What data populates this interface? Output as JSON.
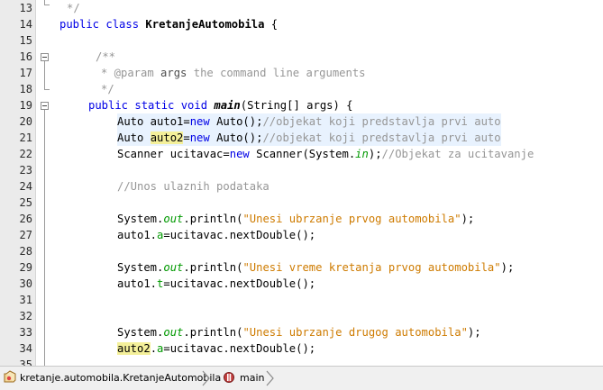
{
  "editor": {
    "line_numbers": [
      "13",
      "14",
      "15",
      "16",
      "17",
      "18",
      "19",
      "20",
      "21",
      "22",
      "23",
      "24",
      "25",
      "26",
      "27",
      "28",
      "29",
      "30",
      "31",
      "32",
      "33",
      "34",
      "35"
    ],
    "lines": {
      "l13": [
        "*/"
      ],
      "l14": [
        "public class ",
        "KretanjeAutomobila",
        " {"
      ],
      "l16": [
        "/**"
      ],
      "l17": [
        "* @param ",
        "args",
        " the command line arguments"
      ],
      "l18": [
        "*/"
      ],
      "l19": [
        "public static void ",
        "main",
        "(String[] args) {"
      ],
      "l20": [
        "Auto auto1=",
        "new",
        " Auto();",
        "//objekat koji predstavlja prvi auto"
      ],
      "l21": [
        "Auto ",
        "auto2",
        "=",
        "new",
        " Auto();",
        "//objekat koji predstavlja prvi auto"
      ],
      "l22": [
        "Scanner ucitavac=",
        "new",
        " Scanner(System.",
        "in",
        ");",
        "//Objekat za ucitavanje"
      ],
      "l24": [
        "//Unos ulaznih podataka"
      ],
      "l26": [
        "System.",
        "out",
        ".println(",
        "\"Unesi ubrzanje prvog automobila\"",
        ");"
      ],
      "l27": [
        "auto1.",
        "a",
        "=ucitavac.nextDouble();"
      ],
      "l29": [
        "System.",
        "out",
        ".println(",
        "\"Unesi vreme kretanja prvog automobila\"",
        ");"
      ],
      "l30": [
        "auto1.",
        "t",
        "=ucitavac.nextDouble();"
      ],
      "l33": [
        "System.",
        "out",
        ".println(",
        "\"Unesi ubrzanje drugog automobila\"",
        ");"
      ],
      "l34": [
        "auto2",
        ".",
        "a",
        "=ucitavac.nextDouble();"
      ]
    },
    "colors": {
      "keyword": "#0000e6",
      "comment": "#969696",
      "string": "#ce7b00",
      "field": "#009900",
      "highlight": "#f4f09a"
    }
  },
  "navigation": {
    "class_crumb": "kretanje.automobila.KretanjeAutomobila",
    "class_icon": "class-icon",
    "method_crumb": "main",
    "method_icon": "method-icon",
    "separator_icon": "chevron-right-icon"
  }
}
